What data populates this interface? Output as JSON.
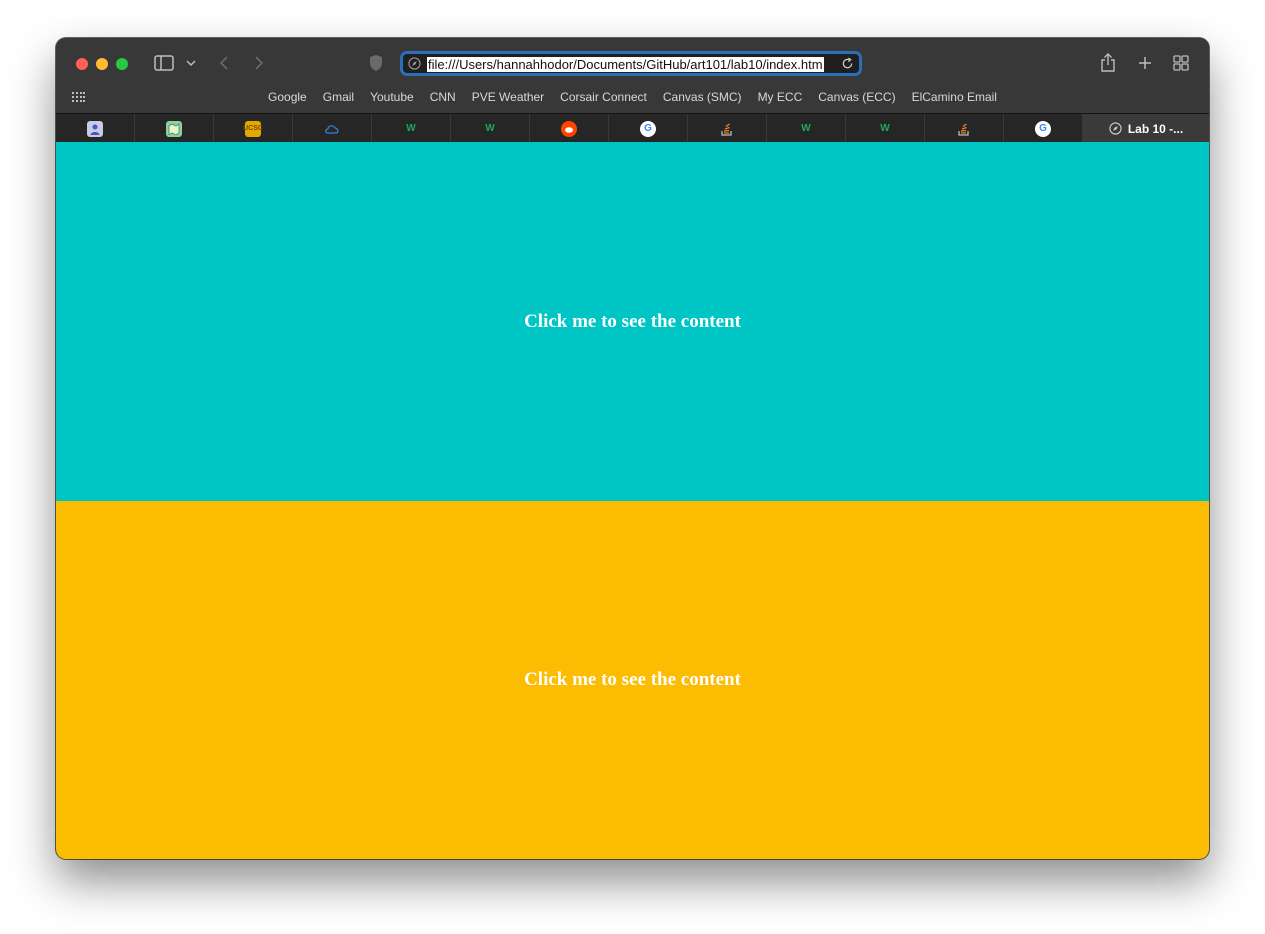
{
  "browser": {
    "address_bar": "file:///Users/hannahhodor/Documents/GitHub/art101/lab10/index.htm",
    "bookmarks": [
      "Google",
      "Gmail",
      "Youtube",
      "CNN",
      "PVE Weather",
      "Corsair Connect",
      "Canvas (SMC)",
      "My ECC",
      "Canvas (ECC)",
      "ElCamino Email"
    ],
    "tabs": [
      {
        "icon": "profile-icon"
      },
      {
        "icon": "map-icon"
      },
      {
        "icon": "ucsc-icon"
      },
      {
        "icon": "cloud-icon"
      },
      {
        "icon": "w-icon"
      },
      {
        "icon": "w-icon"
      },
      {
        "icon": "reddit-icon"
      },
      {
        "icon": "google-icon"
      },
      {
        "icon": "stack-overflow-icon"
      },
      {
        "icon": "w-icon"
      },
      {
        "icon": "w-icon"
      },
      {
        "icon": "stack-overflow-icon"
      },
      {
        "icon": "google-icon"
      }
    ],
    "active_tab": "Lab 10 -..."
  },
  "page": {
    "panels": [
      {
        "label": "Click me to see the content",
        "color": "#00c5c5"
      },
      {
        "label": "Click me to see the content",
        "color": "#fcbc02"
      }
    ]
  }
}
